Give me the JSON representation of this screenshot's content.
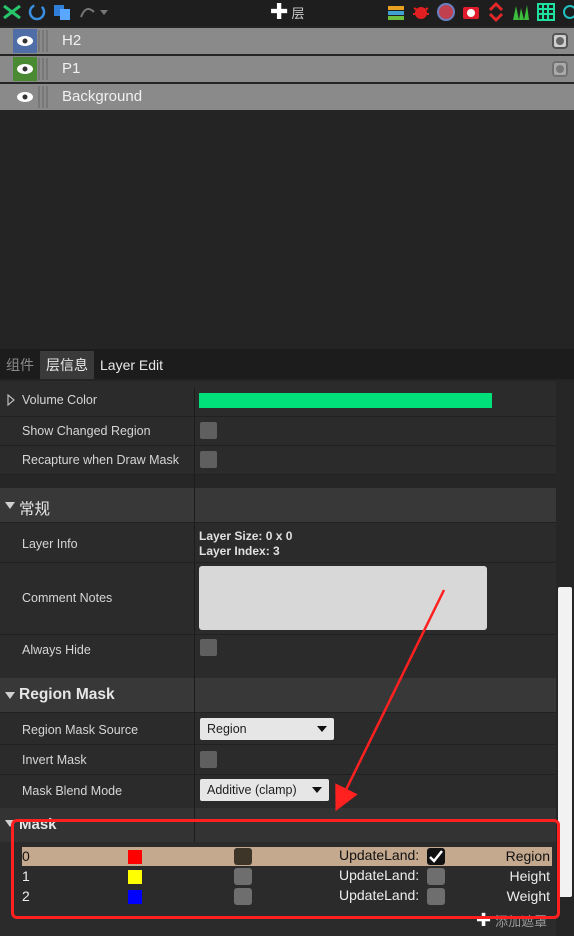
{
  "toolbar": {
    "add_layer_label": "层",
    "icons": [
      "shuffle-icon",
      "refresh-icon",
      "copy-icon",
      "brush-icon",
      "layers-stack-icon",
      "bug-icon",
      "globe-icon",
      "camera-icon",
      "swap-icon",
      "grass-icon",
      "grid-icon",
      "target-icon"
    ]
  },
  "layers": [
    {
      "name": "H2",
      "eye_color": "#4f6ea8",
      "selected": false
    },
    {
      "name": "P1",
      "eye_color": "#4a8a32",
      "selected": false
    },
    {
      "name": "Background",
      "eye_color": "#8a8a8a",
      "selected": false
    }
  ],
  "tabs": [
    {
      "label": "组件",
      "active": false
    },
    {
      "label": "层信息",
      "active": true
    },
    {
      "label": "Layer Edit",
      "active": false
    }
  ],
  "properties": {
    "volume_color_label": "Volume Color",
    "volume_color": "#00e07a",
    "show_changed_region_label": "Show Changed Region",
    "recapture_label": "Recapture when Draw Mask"
  },
  "general": {
    "title": "常规",
    "layer_info_label": "Layer Info",
    "layer_size": "Layer Size: 0 x 0",
    "layer_index": "Layer Index: 3",
    "comment_notes_label": "Comment Notes",
    "always_hide_label": "Always Hide"
  },
  "region_mask": {
    "title": "Region Mask",
    "source_label": "Region Mask Source",
    "source_value": "Region",
    "invert_label": "Invert Mask",
    "blend_label": "Mask Blend Mode",
    "blend_value": "Additive (clamp)"
  },
  "mask": {
    "title": "Mask",
    "rows": [
      {
        "index": "0",
        "color": "#ff0000",
        "update_label": "UpdateLand:",
        "update_checked": true,
        "name": "Region"
      },
      {
        "index": "1",
        "color": "#ffff00",
        "update_label": "UpdateLand:",
        "update_checked": false,
        "name": "Height"
      },
      {
        "index": "2",
        "color": "#0000ff",
        "update_label": "UpdateLand:",
        "update_checked": false,
        "name": "Weight"
      }
    ],
    "add_label": "添加遮罩"
  }
}
